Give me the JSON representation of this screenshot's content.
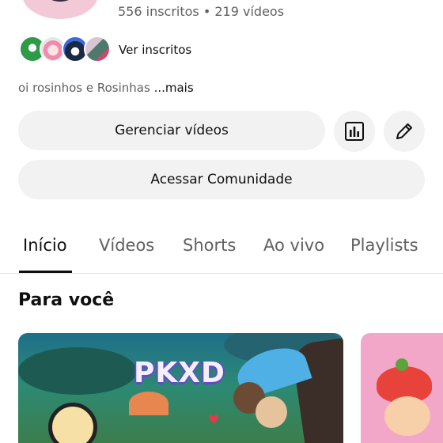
{
  "channel": {
    "stats": "556 inscritos • 219 vídeos",
    "see_subscribers_label": "Ver inscritos",
    "description": "oi rosinhos e Rosinhas ",
    "more_label": "...mais"
  },
  "actions": {
    "manage_videos_label": "Gerenciar vídeos",
    "community_label": "Acessar Comunidade",
    "stats_icon": "bar-chart-icon",
    "edit_icon": "pencil-icon"
  },
  "tabs": [
    {
      "label": "Início",
      "active": true
    },
    {
      "label": "Vídeos",
      "active": false
    },
    {
      "label": "Shorts",
      "active": false
    },
    {
      "label": "Ao vivo",
      "active": false
    },
    {
      "label": "Playlists",
      "active": false
    }
  ],
  "section": {
    "title": "Para você"
  },
  "videos": [
    {
      "thumbnail_text": "PKXD"
    },
    {
      "thumbnail_text": ""
    }
  ]
}
